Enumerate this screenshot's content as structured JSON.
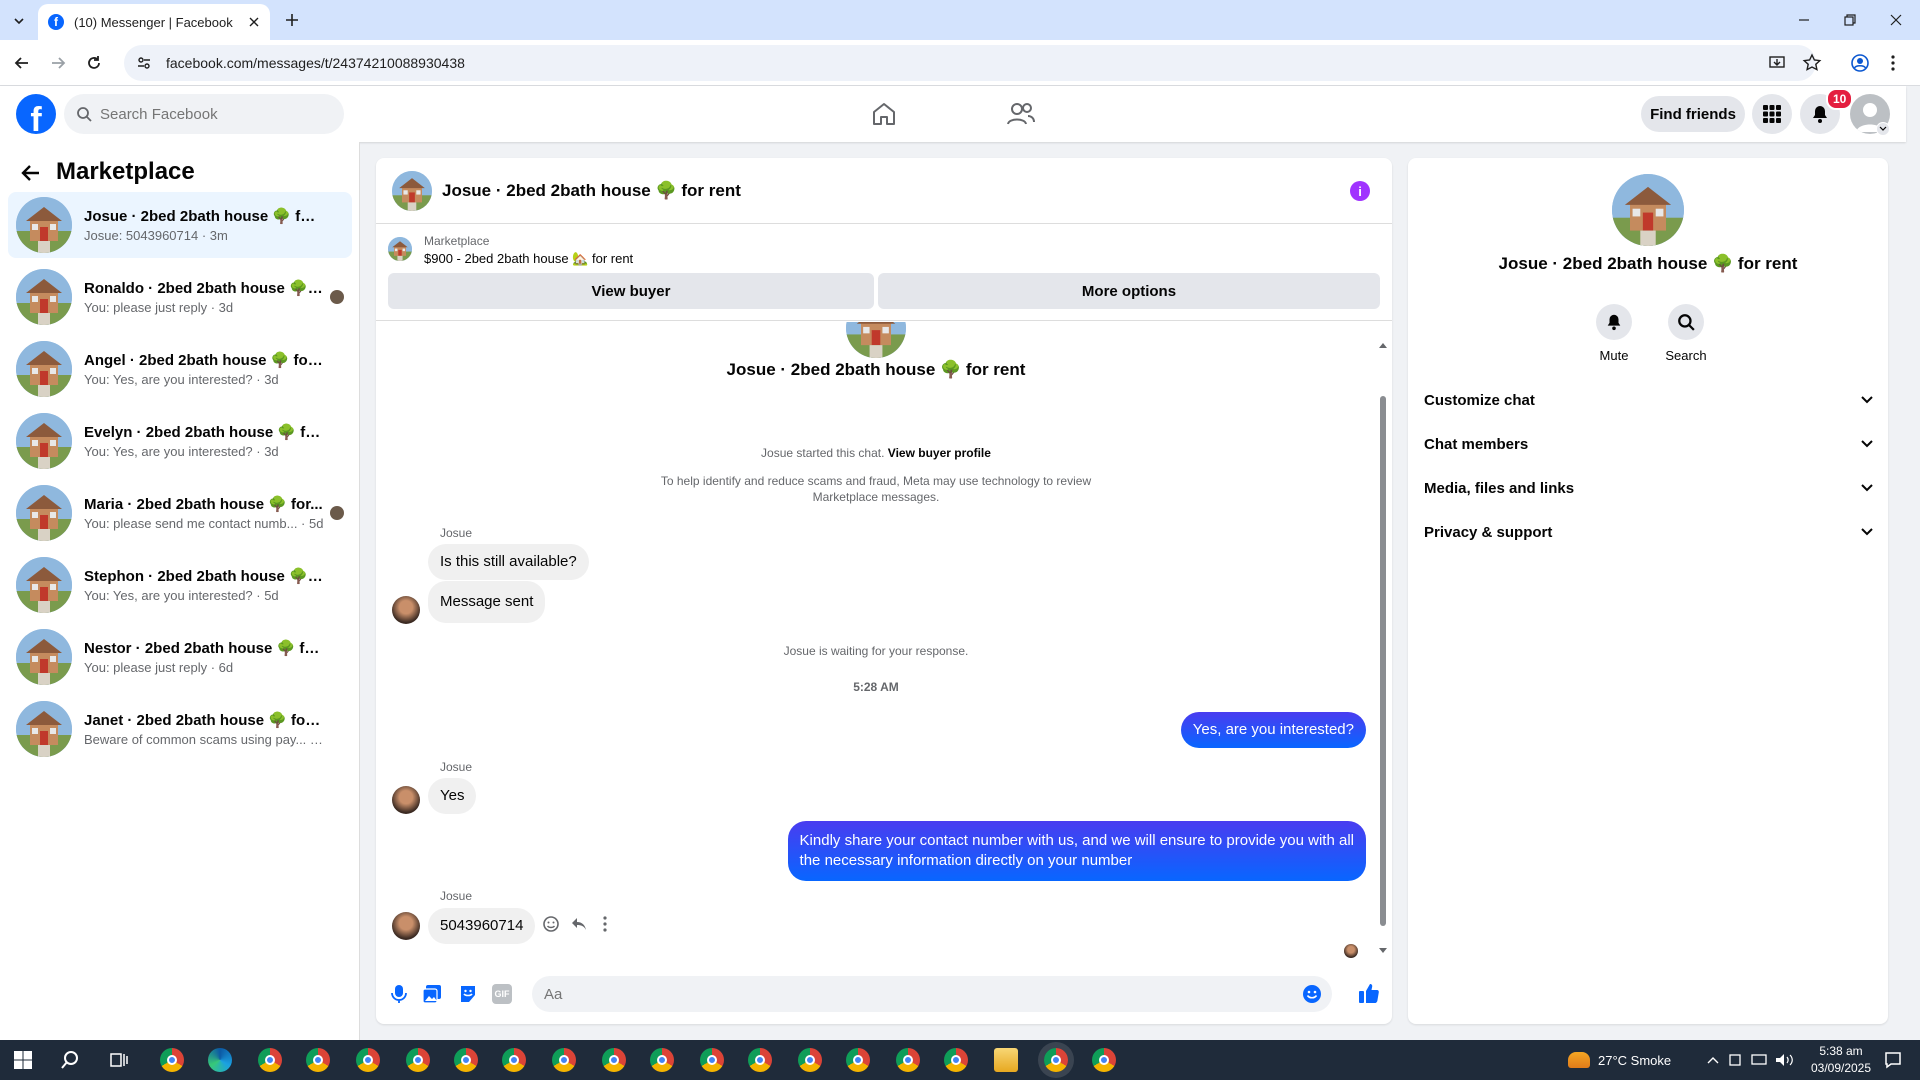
{
  "browser": {
    "tab_title": "(10) Messenger | Facebook",
    "url": "facebook.com/messages/t/24374210088930438"
  },
  "fb_header": {
    "search_placeholder": "Search Facebook",
    "find_friends": "Find friends",
    "notification_count": "10"
  },
  "sidebar": {
    "title": "Marketplace",
    "conversations": [
      {
        "name": "Josue · 2bed 2bath house 🌳 for r...",
        "preview": "Josue: 5043960714 · 3m"
      },
      {
        "name": "Ronaldo · 2bed 2bath house 🌳 ...",
        "preview": "You: please just reply · 3d"
      },
      {
        "name": "Angel · 2bed 2bath house 🌳 for r...",
        "preview": "You: Yes, are you interested? · 3d"
      },
      {
        "name": "Evelyn · 2bed 2bath house 🌳 for r...",
        "preview": "You: Yes, are you interested? · 3d"
      },
      {
        "name": "Maria · 2bed 2bath house 🌳 for...",
        "preview": "You: please send me contact numb... · 5d"
      },
      {
        "name": "Stephon · 2bed 2bath house 🌳 fo...",
        "preview": "You: Yes, are you interested? · 5d"
      },
      {
        "name": "Nestor · 2bed 2bath house 🌳 for ...",
        "preview": "You: please just reply · 6d"
      },
      {
        "name": "Janet · 2bed 2bath house 🌳 for rent",
        "preview": "Beware of common scams using pay... · 1w"
      }
    ]
  },
  "chat": {
    "header_name": "Josue · 2bed 2bath house 🌳 for rent",
    "marketplace_label": "Marketplace",
    "listing": "$900 - 2bed 2bath house 🏡 for rent",
    "view_buyer": "View buyer",
    "more_options": "More options",
    "intro_name": "Josue · 2bed 2bath house 🌳 for rent",
    "started_text": "Josue started this chat.",
    "view_buyer_profile": "View buyer profile",
    "scam_notice_1": "To help identify and reduce scams and fraud, Meta may use technology to review",
    "scam_notice_2": "Marketplace messages.",
    "sender_name": "Josue",
    "msg1": "Is this still available?",
    "msg2": "Message sent",
    "waiting": "Josue is waiting for your response.",
    "time": "5:28 AM",
    "out1": "Yes, are you interested?",
    "msg3": "Yes",
    "out2_line1": "Kindly share your contact number with us, and we will ensure to provide you with all",
    "out2_line2": "the necessary information directly on your number",
    "msg4": "5043960714",
    "input_placeholder": "Aa"
  },
  "right_panel": {
    "name": "Josue · 2bed 2bath house 🌳 for rent",
    "mute": "Mute",
    "search": "Search",
    "sections": [
      "Customize chat",
      "Chat members",
      "Media, files and links",
      "Privacy & support"
    ]
  },
  "taskbar": {
    "weather": "27°C  Smoke",
    "clock_time": "5:38 am",
    "clock_date": "03/09/2025"
  },
  "colors": {
    "fb_blue": "#0866ff",
    "out_bubble": "#0a5cff",
    "info_purple": "#a033ff"
  }
}
